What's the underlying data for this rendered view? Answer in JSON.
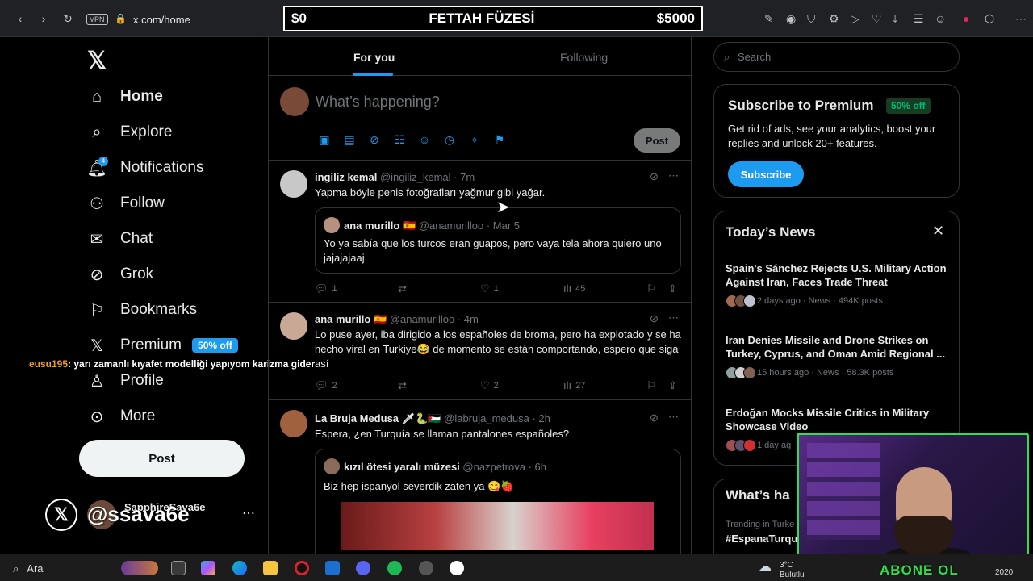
{
  "browser": {
    "vpn_label": "VPN",
    "url": "x.com/home"
  },
  "stream_bar": {
    "left": "$0",
    "title": "FETTAH FÜZESİ",
    "right": "$5000"
  },
  "nav": {
    "items": [
      {
        "label": "Home",
        "icon": "home-icon"
      },
      {
        "label": "Explore",
        "icon": "search-icon"
      },
      {
        "label": "Notifications",
        "icon": "bell-icon",
        "badge": "4"
      },
      {
        "label": "Follow",
        "icon": "follow-icon"
      },
      {
        "label": "Chat",
        "icon": "mail-icon"
      },
      {
        "label": "Grok",
        "icon": "grok-icon"
      },
      {
        "label": "Bookmarks",
        "icon": "bookmark-icon"
      },
      {
        "label": "Premium",
        "icon": "x-icon",
        "pill": "50% off"
      },
      {
        "label": "Profile",
        "icon": "person-icon"
      },
      {
        "label": "More",
        "icon": "more-circle-icon"
      }
    ],
    "post_label": "Post",
    "account_name": "SapphireSava6e",
    "account_handle_overlay": "@ssava6e"
  },
  "chat_overlay": {
    "user": "eusu195",
    "message": ": yarı zamanlı kıyafet modelliği yapıyom karizma gider"
  },
  "feed": {
    "tabs": [
      "For you",
      "Following"
    ],
    "composer_placeholder": "What’s happening?",
    "post_label": "Post",
    "tweets": [
      {
        "name": "ingiliz kemal",
        "handle": "@ingiliz_kemal",
        "time": "· 7m",
        "body": "Yapma böyle penis fotoğrafları yağmur gibi yağar.",
        "quote": {
          "name": "ana murillo 🇪🇸",
          "handle": "@anamurilloo",
          "time": "· Mar 5",
          "body": "Yo ya sabía que los turcos eran guapos, pero vaya tela ahora quiero uno jajajajaaj"
        },
        "replies": "1",
        "retweets": "",
        "likes": "1",
        "views": "45"
      },
      {
        "name": "ana murillo 🇪🇸",
        "handle": "@anamurilloo",
        "time": "· 4m",
        "body": "Lo puse ayer, iba dirigido a los españoles de broma, pero ha explotado y se ha hecho viral en Turkiye😂 de momento se están comportando, espero que siga así",
        "replies": "2",
        "retweets": "",
        "likes": "2",
        "views": "27"
      },
      {
        "name": "La Bruja Medusa 🗡🐍🇵🇸",
        "handle": "@labruja_medusa",
        "time": "· 2h",
        "body": "Espera, ¿en Turquía se llaman pantalones españoles?",
        "quote": {
          "name": "kızıl ötesi yaralı müzesi",
          "handle": "@nazpetrova",
          "time": "· 6h",
          "body": "Biz hep ispanyol severdik zaten ya 😋🍓"
        }
      }
    ]
  },
  "right": {
    "search_placeholder": "Search",
    "premium": {
      "title": "Subscribe to Premium",
      "pill": "50% off",
      "desc": "Get rid of ads, see your analytics, boost your replies and unlock 20+ features.",
      "button": "Subscribe"
    },
    "news": {
      "title": "Today’s News",
      "items": [
        {
          "headline": "Spain's Sánchez Rejects U.S. Military Action Against Iran, Faces Trade Threat",
          "meta": "2 days ago · News · 494K posts"
        },
        {
          "headline": "Iran Denies Missile and Drone Strikes on Turkey, Cyprus, and Oman Amid Regional ...",
          "meta": "15 hours ago · News · 58.3K posts"
        },
        {
          "headline": "Erdoğan Mocks Missile Critics in Military Showcase Video",
          "meta": "1 day ag"
        }
      ]
    },
    "whats_happening": {
      "title": "What’s ha",
      "trend_meta": "Trending in Turke",
      "trend_tag": "#EspanaTurqu"
    }
  },
  "webcam": {
    "caption": "ABONE OL"
  },
  "taskbar": {
    "search_label": "Ara",
    "weather_temp": "3°C",
    "weather_cond": "Bulutlu",
    "clock": "2020"
  },
  "colors": {
    "accent": "#1d9bf0",
    "green": "#00ba7c",
    "webcam_frame": "#2fe04a",
    "background": "#000000"
  }
}
